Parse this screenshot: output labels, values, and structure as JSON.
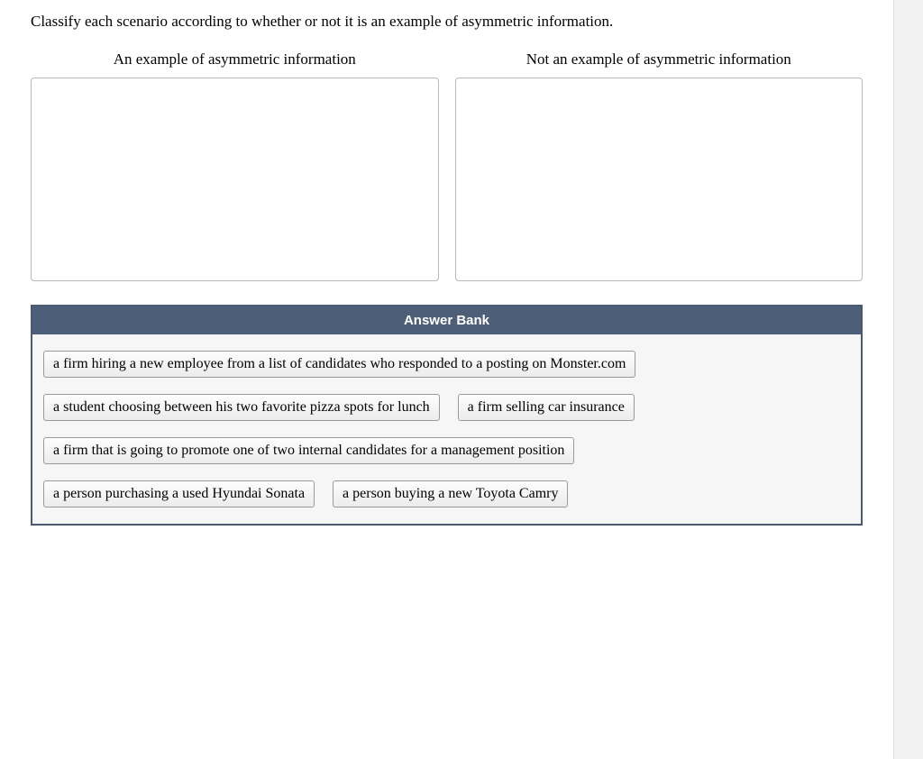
{
  "question": "Classify each scenario according to whether or not it is an example of asymmetric information.",
  "zones": {
    "left_label": "An example of asymmetric information",
    "right_label": "Not an example of asymmetric information"
  },
  "answer_bank": {
    "title": "Answer Bank",
    "rows": [
      [
        "a firm hiring a new employee from a list of candidates who responded to a posting on Monster.com"
      ],
      [
        "a student choosing between his two favorite pizza spots for lunch",
        "a firm selling car insurance"
      ],
      [
        "a firm that is going to promote one of two internal candidates for a management position"
      ],
      [
        "a person purchasing a used Hyundai Sonata",
        "a person buying a new Toyota Camry"
      ]
    ]
  }
}
